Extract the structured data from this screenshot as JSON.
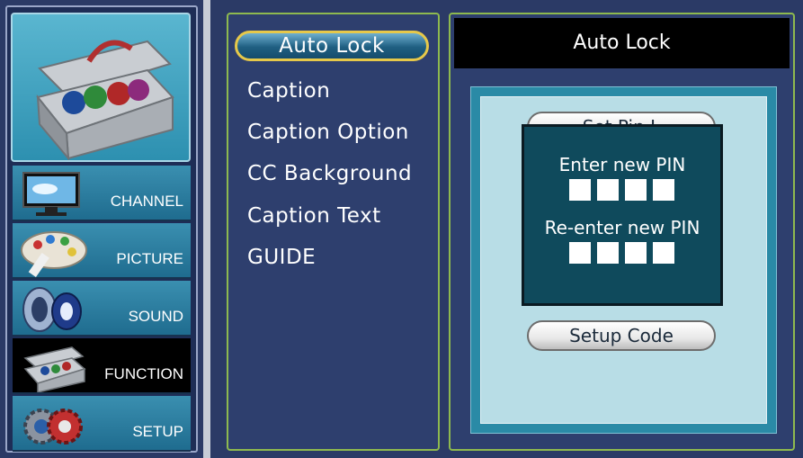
{
  "sidebar": {
    "items": [
      {
        "label": "CHANNEL",
        "icon": "tv-icon"
      },
      {
        "label": "PICTURE",
        "icon": "palette-icon"
      },
      {
        "label": "SOUND",
        "icon": "speaker-icon"
      },
      {
        "label": "FUNCTION",
        "icon": "toolbox-icon",
        "active": true
      },
      {
        "label": "SETUP",
        "icon": "gears-icon"
      }
    ],
    "hero_icon": "toolbox-icon"
  },
  "menu": {
    "items": [
      "Auto Lock",
      "Caption",
      "Caption Option",
      "CC Background",
      "Caption Text",
      "GUIDE"
    ],
    "selected": "Auto Lock"
  },
  "panel": {
    "title": "Auto Lock",
    "hidden_button_label": "Set Pin L",
    "setup_code_label": "Setup Code"
  },
  "pin_dialog": {
    "enter_label": "Enter new PIN",
    "reenter_label": "Re-enter new PIN",
    "digits": 4
  },
  "colors": {
    "accent_border": "#8eb94f",
    "selected_outline": "#e6c84a",
    "dialog_bg": "#0f4a5c"
  }
}
